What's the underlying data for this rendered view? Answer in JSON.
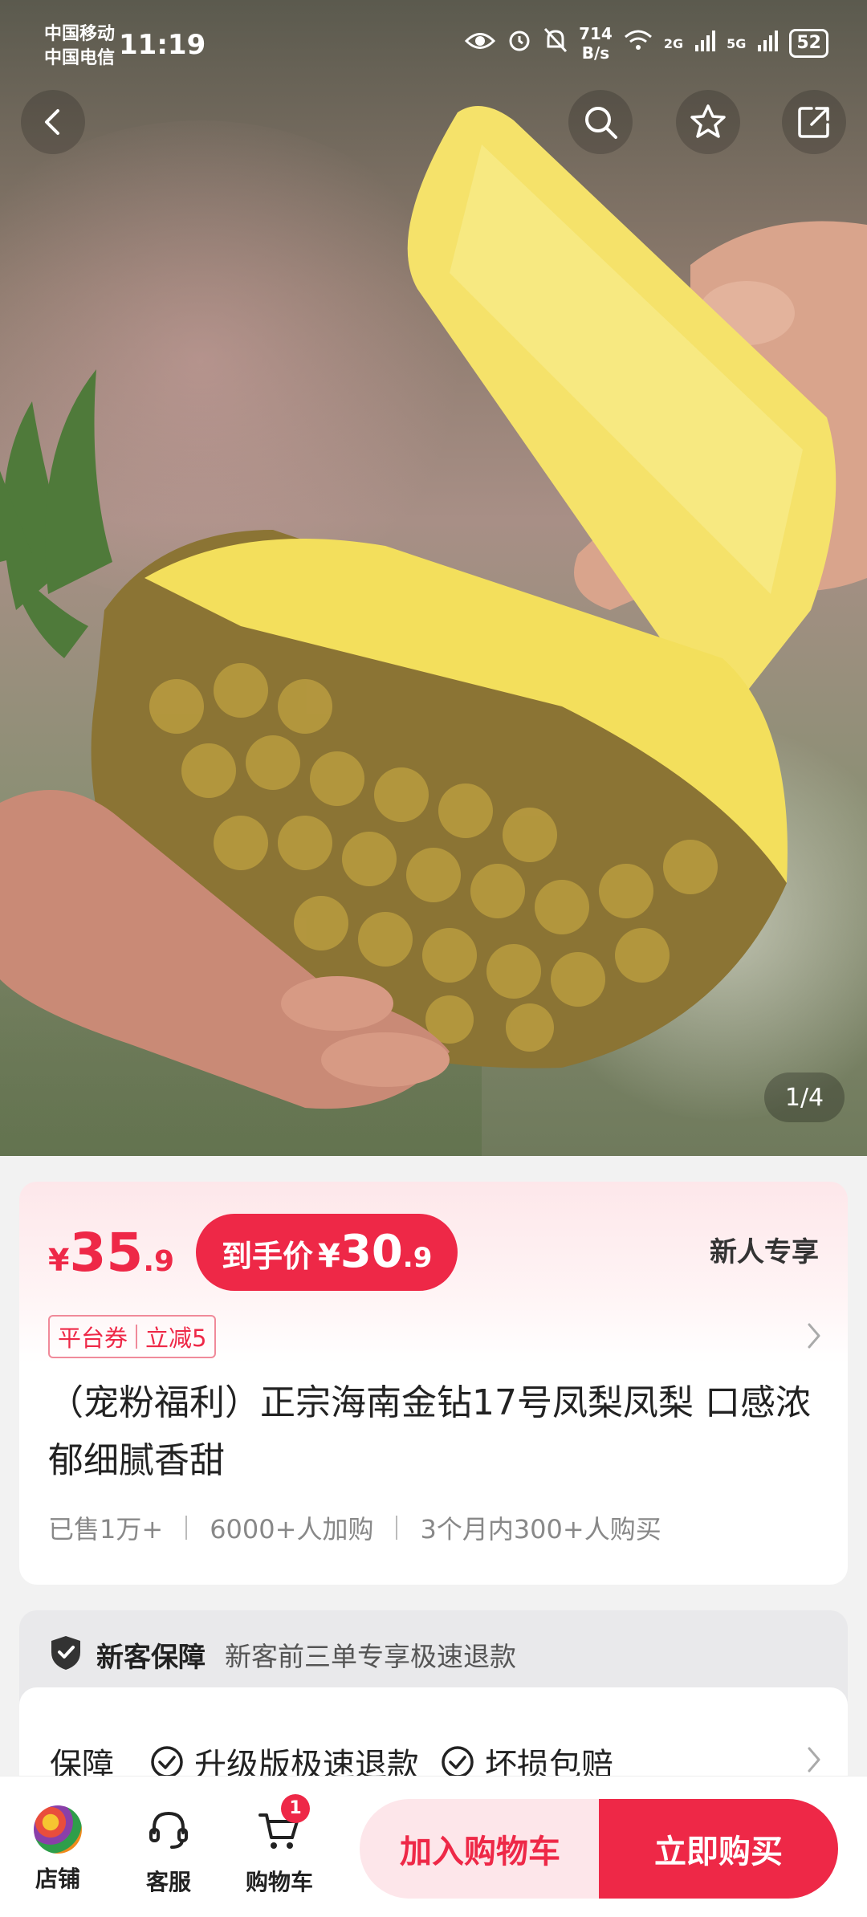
{
  "status_bar": {
    "carrier_1": "中国移动",
    "carrier_2": "中国电信",
    "time": "11:19",
    "net_speed_value": "714",
    "net_speed_unit": "B/s",
    "signal_1": "2G",
    "signal_2": "5G",
    "battery": "52"
  },
  "gallery": {
    "page_indicator": "1/4"
  },
  "price": {
    "currency": "¥",
    "integer": "35",
    "decimal": ".9",
    "final_label": "到手价",
    "final_currency": "¥",
    "final_integer": "30",
    "final_decimal": ".9",
    "new_user_tag": "新人专享"
  },
  "coupon": {
    "type": "平台券",
    "discount": "立减5"
  },
  "product": {
    "title": "（宠粉福利）正宗海南金钻17号凤梨凤梨 口感浓郁细腻香甜",
    "sold": "已售1万+",
    "added_to_cart": "6000+人加购",
    "recent_buyers": "3个月内300+人购买"
  },
  "guarantee": {
    "name": "新客保障",
    "description": "新客前三单专享极速退款",
    "label": "保障",
    "items": [
      "升级版极速退款",
      "坏损包赔"
    ]
  },
  "bottom_bar": {
    "shop_label": "店铺",
    "service_label": "客服",
    "cart_label": "购物车",
    "cart_count": "1",
    "add_to_cart": "加入购物车",
    "buy_now": "立即购买"
  },
  "colors": {
    "accent": "#ee2847",
    "accent_light": "#fde6ea"
  },
  "icons": [
    "back-icon",
    "search-icon",
    "star-icon",
    "share-icon",
    "shield-icon",
    "check-circle-icon",
    "chevron-right-icon",
    "service-headset-icon",
    "cart-icon"
  ]
}
